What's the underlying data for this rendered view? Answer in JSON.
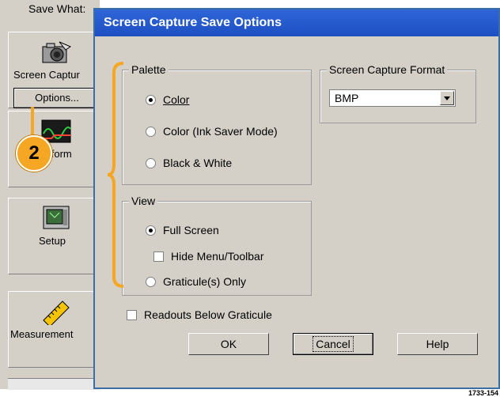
{
  "background": {
    "save_what_label": "Save What:",
    "nav_items": [
      {
        "label": "Screen Captur",
        "icon": "camera-icon"
      },
      {
        "label": "veform",
        "icon": "waveform-icon"
      },
      {
        "label": "Setup",
        "icon": "setup-icon"
      },
      {
        "label": "Measurement",
        "icon": "measurement-ruler-icon"
      }
    ],
    "options_button": "Options..."
  },
  "callout": {
    "number": "2",
    "color": "#f5a623"
  },
  "dialog": {
    "title": "Screen Capture Save Options",
    "palette": {
      "legend": "Palette",
      "options": [
        {
          "label": "Color",
          "selected": true
        },
        {
          "label": "Color (Ink Saver Mode)",
          "selected": false
        },
        {
          "label": "Black & White",
          "selected": false
        }
      ]
    },
    "view": {
      "legend": "View",
      "full_screen": "Full Screen",
      "hide_menu": "Hide Menu/Toolbar",
      "graticule_only": "Graticule(s) Only"
    },
    "format": {
      "legend": "Screen Capture Format",
      "selected": "BMP"
    },
    "readouts_below": "Readouts Below Graticule",
    "buttons": {
      "ok": "OK",
      "cancel": "Cancel",
      "help": "Help"
    }
  },
  "caption": "1733-154"
}
